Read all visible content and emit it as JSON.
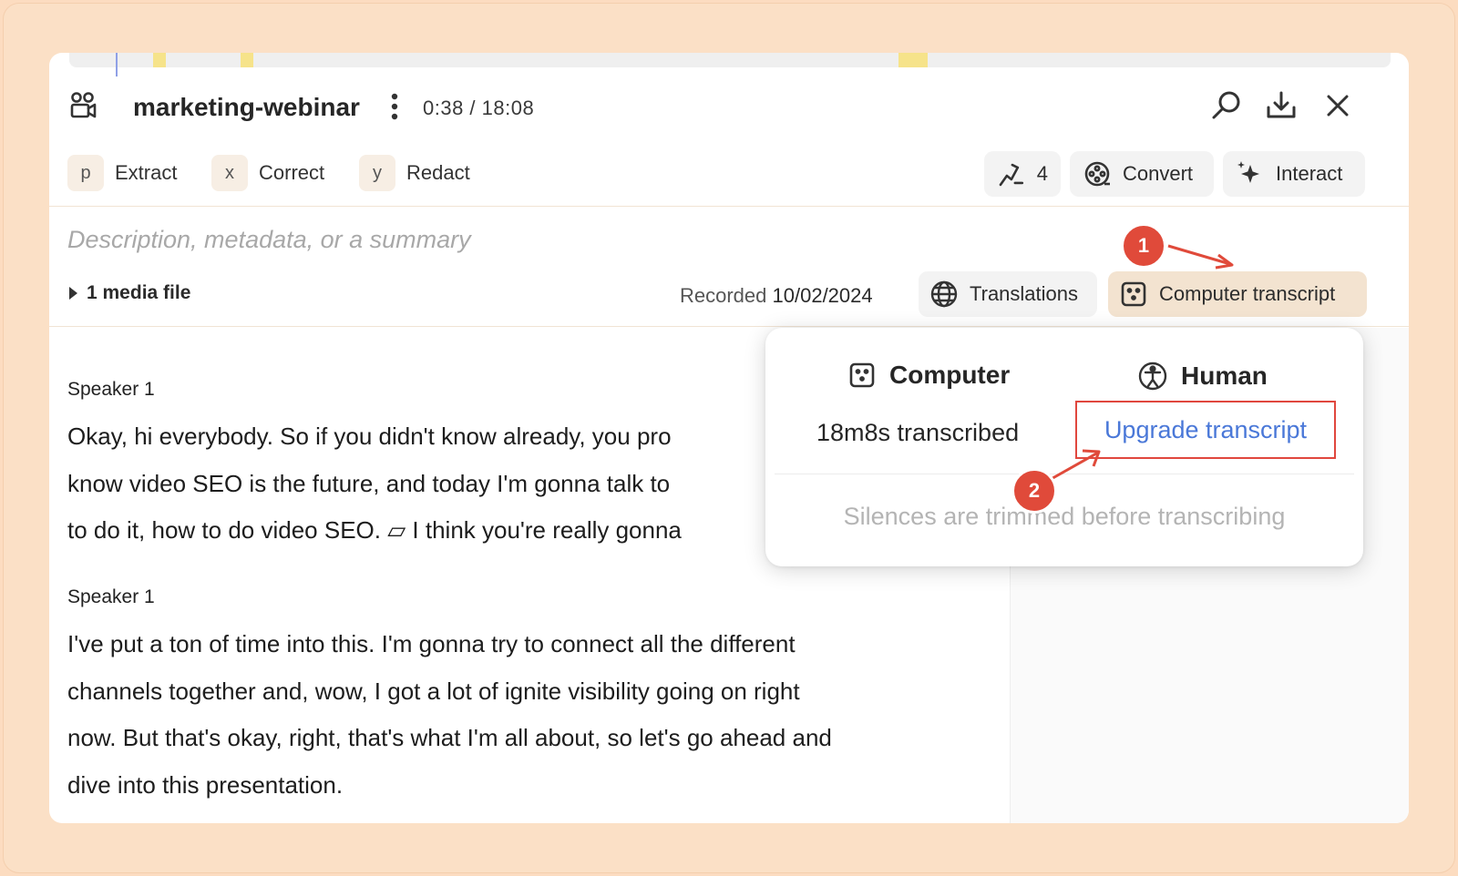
{
  "header": {
    "title": "marketing-webinar",
    "time": "0:38 / 18:08"
  },
  "actions": [
    {
      "key": "p",
      "label": "Extract"
    },
    {
      "key": "x",
      "label": "Correct"
    },
    {
      "key": "y",
      "label": "Redact"
    }
  ],
  "toolbar": {
    "speakers_count": "4",
    "convert_label": "Convert",
    "interact_label": "Interact"
  },
  "description_placeholder": "Description, metadata, or a summary",
  "media_files_label": "1 media file",
  "recorded": {
    "label": "Recorded",
    "date": "10/02/2024"
  },
  "pills": {
    "translations": "Translations",
    "computer_transcript": "Computer transcript"
  },
  "transcript": [
    {
      "speaker": "Speaker 1",
      "lines": [
        "Okay, hi everybody. So if you didn't know already, you pro",
        "know video SEO is the future, and today I'm gonna talk to",
        "to do it, how to do video SEO. ▱ I think you're really gonna"
      ]
    },
    {
      "speaker": "Speaker 1",
      "lines": [
        "I've put a ton of time into this. I'm gonna try to connect all the different",
        "channels together and, wow, I got a lot of ignite visibility going on right",
        "now. But that's okay, right, that's what I'm all about, so let's go ahead and",
        "dive into this presentation."
      ]
    }
  ],
  "popover": {
    "computer_heading": "Computer",
    "human_heading": "Human",
    "transcribed": "18m8s transcribed",
    "upgrade_label": "Upgrade transcript",
    "note": "Silences are trimmed before transcribing"
  },
  "steps": [
    "1",
    "2"
  ],
  "colors": {
    "background": "#fcdcc0",
    "accent_link": "#4a78d8",
    "step_red": "#e04a3a",
    "active_pill": "#f3e3d0"
  }
}
